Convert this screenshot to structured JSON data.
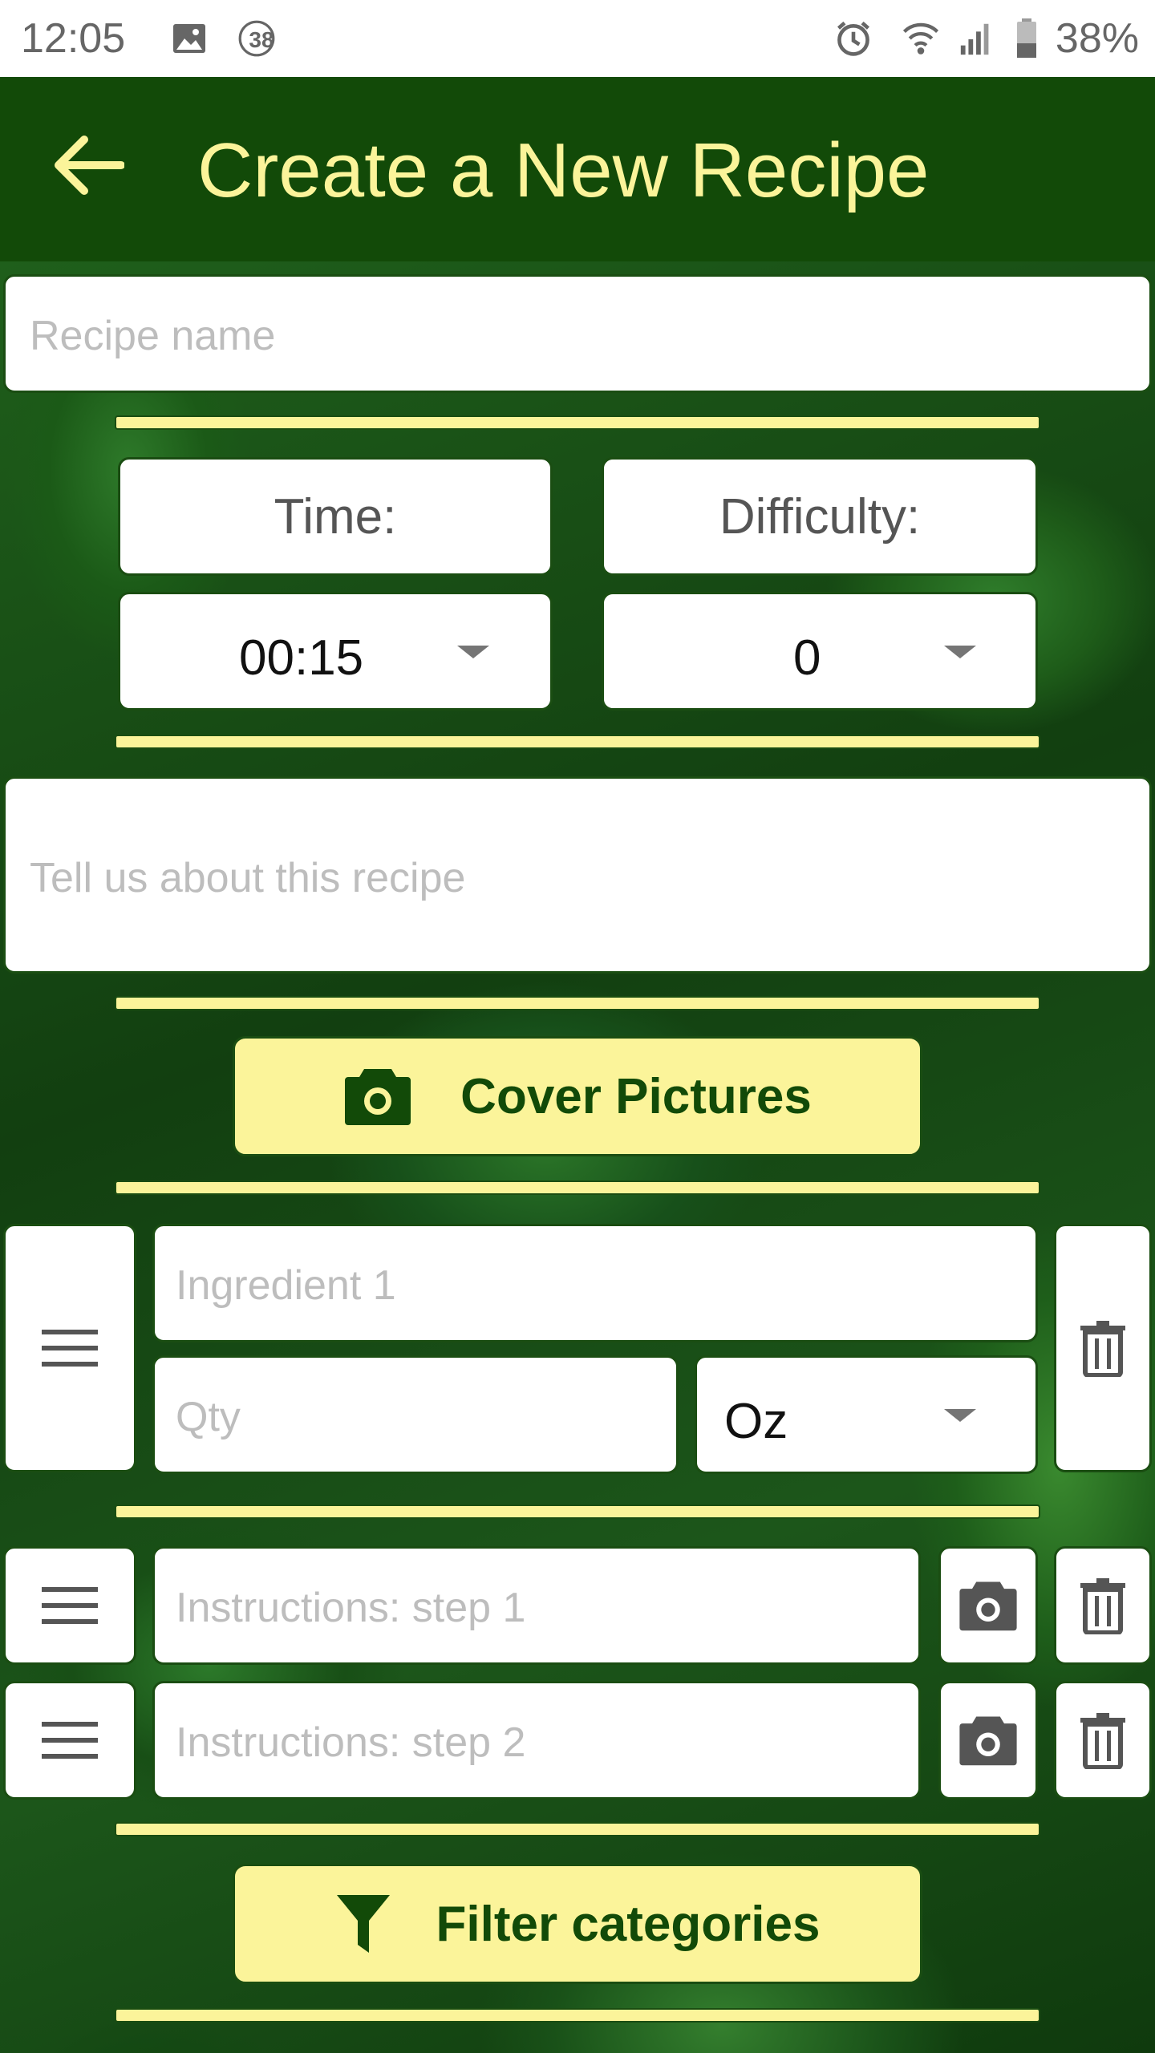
{
  "status_bar": {
    "time": "12:05",
    "notification_count": "38",
    "battery_percent": "38%"
  },
  "app_bar": {
    "title": "Create a New Recipe"
  },
  "form": {
    "recipe_name_placeholder": "Recipe name",
    "time_label": "Time:",
    "difficulty_label": "Difficulty:",
    "time_value": "00:15",
    "difficulty_value": "0",
    "description_placeholder": "Tell us about this recipe",
    "cover_pictures_label": "Cover Pictures",
    "ingredient_placeholder": "Ingredient 1",
    "qty_placeholder": "Qty",
    "unit_value": "Oz",
    "instructions": [
      {
        "placeholder": "Instructions: step 1"
      },
      {
        "placeholder": "Instructions: step 2"
      }
    ],
    "filter_categories_label": "Filter categories"
  },
  "colors": {
    "app_bar": "#124a08",
    "accent_yellow": "#fbf49a",
    "border_green": "#1a4d12"
  }
}
